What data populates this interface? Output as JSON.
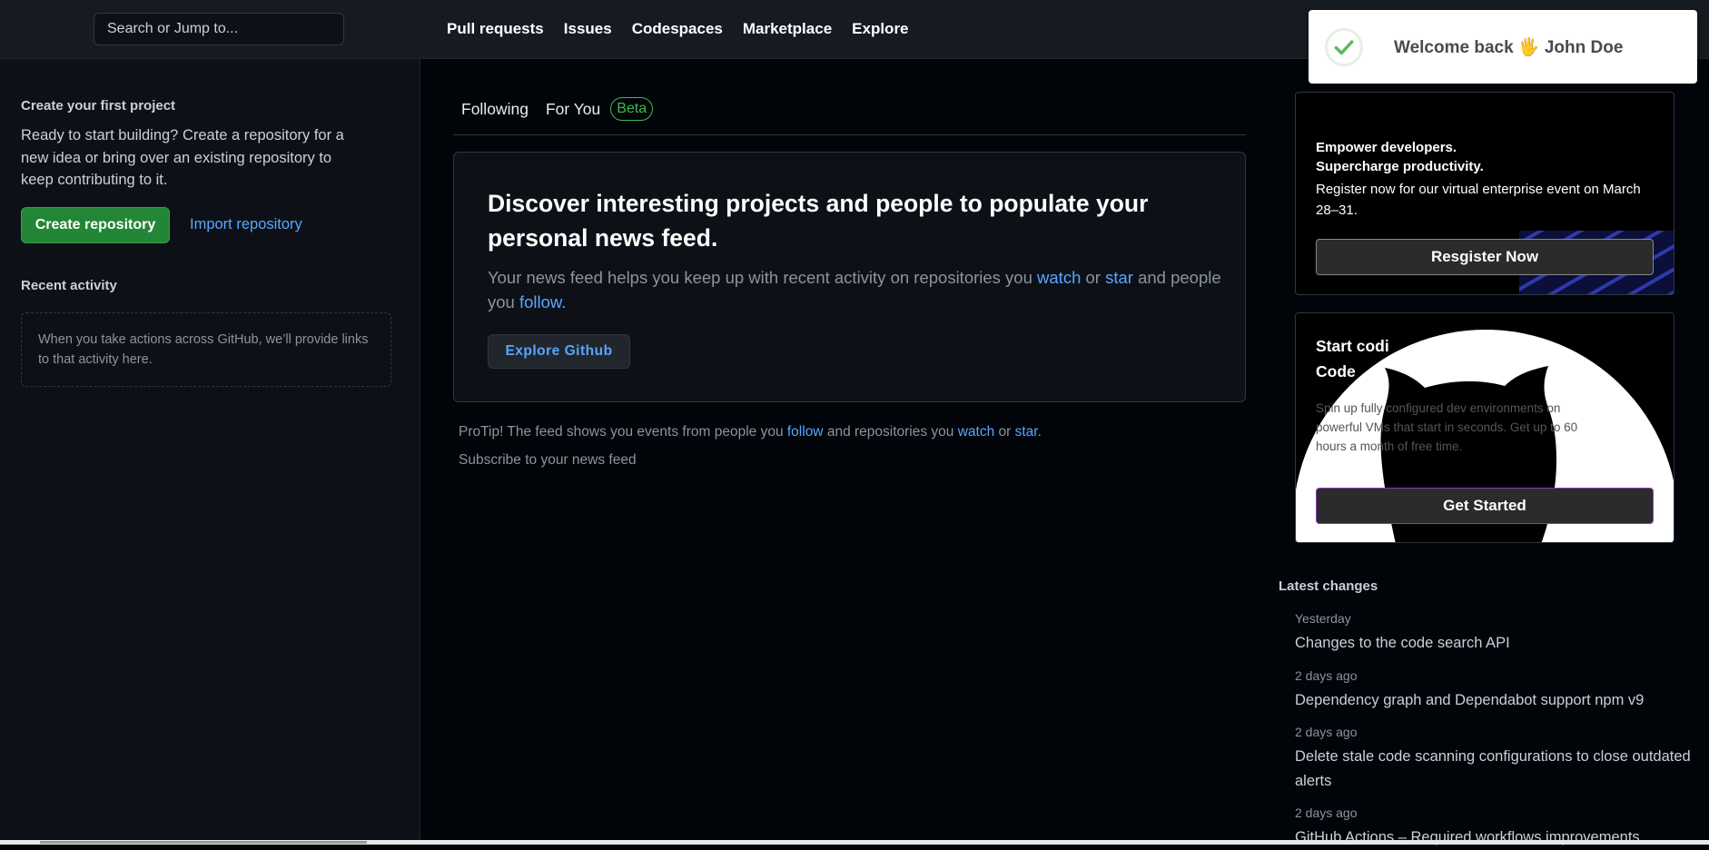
{
  "header": {
    "search_placeholder": "Search or Jump to...",
    "nav": [
      "Pull requests",
      "Issues",
      "Codespaces",
      "Marketplace",
      "Explore"
    ]
  },
  "toast": {
    "message": "Welcome back 🖐 John Doe"
  },
  "sidebar": {
    "first_project_title": "Create your first project",
    "first_project_text": "Ready to start building? Create a repository for a new idea or bring over an existing repository to keep contributing to it.",
    "create_button": "Create repository",
    "import_link": "Import repository",
    "recent_activity_title": "Recent activity",
    "recent_activity_empty": "When you take actions across GitHub, we’ll provide links to that activity here."
  },
  "feed": {
    "tabs": [
      "Following",
      "For You"
    ],
    "beta_badge": "Beta",
    "card_title": "Discover interesting projects and people to populate your personal news feed.",
    "card_body_1": "Your news feed helps you keep up with recent activity on repositories you ",
    "card_watch": "watch",
    "card_or": " or ",
    "card_star": "star",
    "card_body_2": " and people you ",
    "card_follow": "follow.",
    "explore_button": "Explore Github",
    "protip_1": "ProTip! The feed shows you events from people you ",
    "protip_follow": "follow",
    "protip_2": " and repositories you ",
    "protip_watch": "watch",
    "protip_or": " or ",
    "protip_star": "star",
    "protip_end": ".",
    "subscribe": "Subscribe to your news feed"
  },
  "promo_enterprise": {
    "line1": "Empower developers.",
    "line2": "Supercharge productivity.",
    "text": "Register now for our virtual enterprise event on March 28–31.",
    "button": "Resgister Now"
  },
  "promo_codespaces": {
    "line1": "Start codi",
    "line2": "Code",
    "text": "Spin up fully configured dev environments on powerful VMs that start in seconds. Get up to 60 hours a month of free time.",
    "button": "Get Started"
  },
  "latest_changes": {
    "title": "Latest changes",
    "items": [
      {
        "when": "Yesterday",
        "what": "Changes to the code search API"
      },
      {
        "when": "2 days ago",
        "what": "Dependency graph and Dependabot support npm v9"
      },
      {
        "when": "2 days ago",
        "what": "Delete stale code scanning configurations to close outdated alerts"
      },
      {
        "when": "2 days ago",
        "what": "GitHub Actions – Required workflows improvements"
      }
    ]
  },
  "colors": {
    "accent_link": "#58a6ff",
    "primary_button": "#238636",
    "beta": "#3fb950"
  }
}
